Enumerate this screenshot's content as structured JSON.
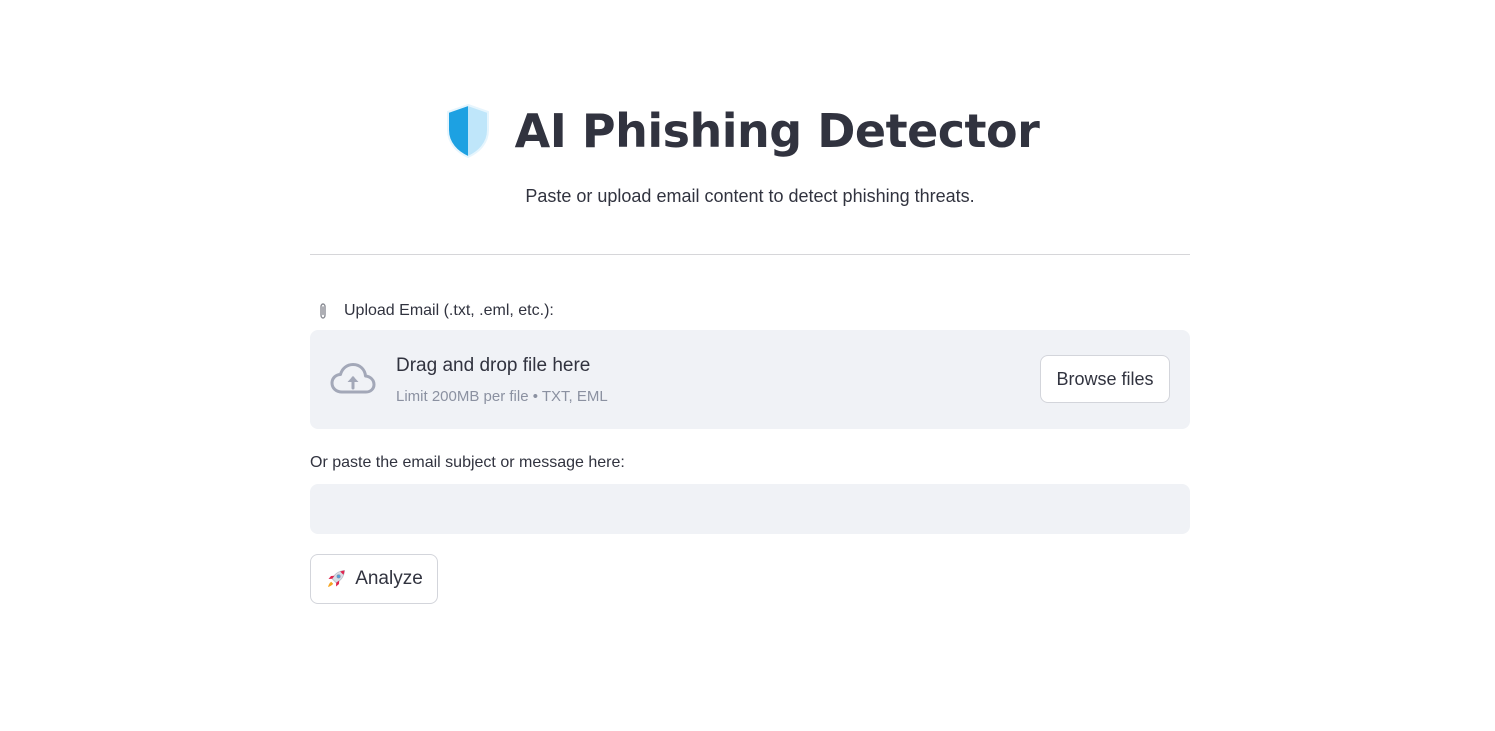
{
  "header": {
    "title": "AI Phishing Detector",
    "icon": "shield-icon",
    "subtitle": "Paste or upload email content to detect phishing threats."
  },
  "uploader": {
    "label": "Upload Email (.txt, .eml, etc.):",
    "label_icon": "paperclip-icon",
    "dropzone_title": "Drag and drop file here",
    "dropzone_limit": "Limit 200MB per file • TXT, EML",
    "dropzone_icon": "cloud-upload-icon",
    "browse_label": "Browse files"
  },
  "paste": {
    "label": "Or paste the email subject or message here:",
    "value": "",
    "placeholder": ""
  },
  "analyze": {
    "label": "Analyze",
    "icon": "rocket-icon"
  },
  "colors": {
    "text": "#31333f",
    "muted": "#8b91a1",
    "panel_bg": "#f0f2f6",
    "border": "#d3d5db",
    "shield_blue": "#29a8e0",
    "shield_light": "#9fd8f5"
  }
}
